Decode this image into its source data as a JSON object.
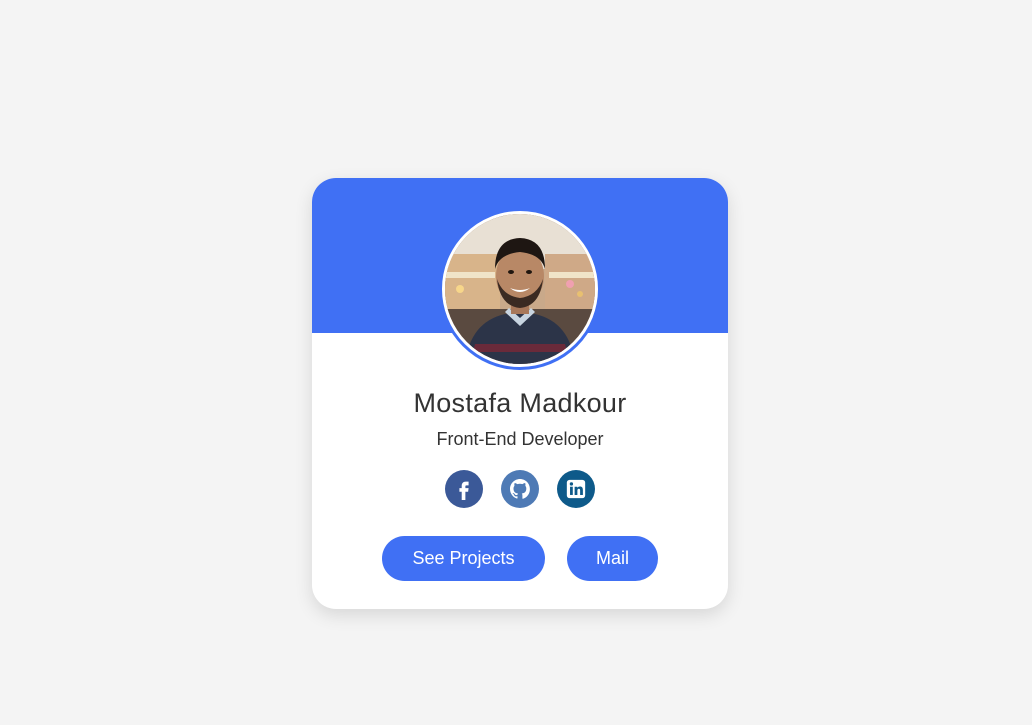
{
  "profile": {
    "name": "Mostafa Madkour",
    "role": "Front-End Developer"
  },
  "socials": [
    {
      "name": "facebook",
      "icon": "facebook-icon",
      "color": "#3b5998"
    },
    {
      "name": "github",
      "icon": "github-icon",
      "color": "#4e7ab5"
    },
    {
      "name": "linkedin",
      "icon": "linkedin-icon",
      "color": "#0e5a8a"
    }
  ],
  "buttons": {
    "projects_label": "See Projects",
    "mail_label": "Mail"
  },
  "colors": {
    "accent": "#4070f4",
    "background": "#f4f4f4",
    "card": "#ffffff",
    "text": "#333333"
  }
}
